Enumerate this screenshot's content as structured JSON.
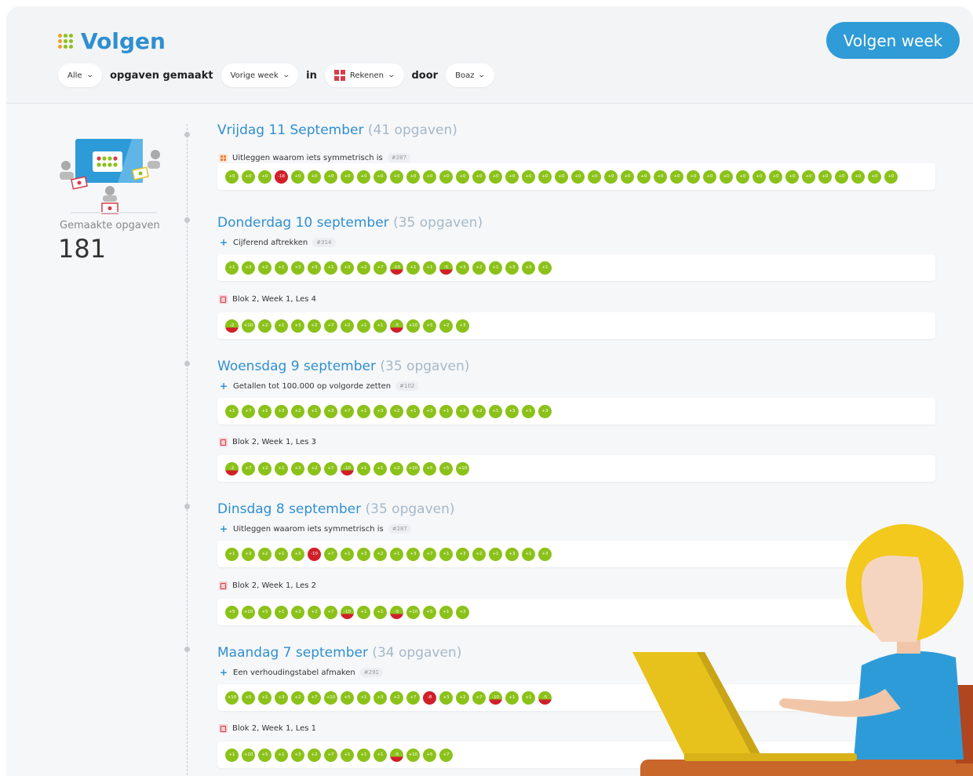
{
  "header": {
    "title": "Volgen",
    "follow_button": "Volgen week",
    "filters": {
      "scope": "Alle",
      "text1": "opgaven gemaakt",
      "period": "Vorige week",
      "text2": "in",
      "subject": "Rekenen",
      "text3": "door",
      "student": "Boaz"
    }
  },
  "sidebar": {
    "count_label": "Gemaakte opgaven",
    "count_value": "181"
  },
  "colors": {
    "accent": "#2f8fd0",
    "correct": "#8bc21a",
    "wrong": "#d01f28"
  },
  "days": [
    {
      "title": "Vrijdag 11 September",
      "count": "(41 opgaven)",
      "tasks": [
        {
          "icon": "grid-icon",
          "label": "Uitleggen waarom iets symmetrisch is",
          "id": "#287",
          "badges": [
            {
              "t": "+0",
              "s": "g"
            },
            {
              "t": "+0",
              "s": "g"
            },
            {
              "t": "+0",
              "s": "g"
            },
            {
              "t": "-18",
              "s": "r"
            },
            {
              "t": "+0",
              "s": "g"
            },
            {
              "t": "+0",
              "s": "g"
            },
            {
              "t": "+0",
              "s": "g"
            },
            {
              "t": "+0",
              "s": "g"
            },
            {
              "t": "+0",
              "s": "g"
            },
            {
              "t": "+0",
              "s": "g"
            },
            {
              "t": "+0",
              "s": "g"
            },
            {
              "t": "+0",
              "s": "g"
            },
            {
              "t": "+0",
              "s": "g"
            },
            {
              "t": "+0",
              "s": "g"
            },
            {
              "t": "+0",
              "s": "g"
            },
            {
              "t": "+0",
              "s": "g"
            },
            {
              "t": "+0",
              "s": "g"
            },
            {
              "t": "+0",
              "s": "g"
            },
            {
              "t": "+0",
              "s": "g"
            },
            {
              "t": "+0",
              "s": "g"
            },
            {
              "t": "+0",
              "s": "g"
            },
            {
              "t": "+0",
              "s": "g"
            },
            {
              "t": "+0",
              "s": "g"
            },
            {
              "t": "+0",
              "s": "g"
            },
            {
              "t": "+0",
              "s": "g"
            },
            {
              "t": "+0",
              "s": "g"
            },
            {
              "t": "+0",
              "s": "g"
            },
            {
              "t": "+0",
              "s": "g"
            },
            {
              "t": "+0",
              "s": "g"
            },
            {
              "t": "+0",
              "s": "g"
            },
            {
              "t": "+0",
              "s": "g"
            },
            {
              "t": "+0",
              "s": "g"
            },
            {
              "t": "+0",
              "s": "g"
            },
            {
              "t": "+0",
              "s": "g"
            },
            {
              "t": "+0",
              "s": "g"
            },
            {
              "t": "+0",
              "s": "g"
            },
            {
              "t": "+0",
              "s": "g"
            },
            {
              "t": "+0",
              "s": "g"
            },
            {
              "t": "+0",
              "s": "g"
            },
            {
              "t": "+0",
              "s": "g"
            },
            {
              "t": "+0",
              "s": "g"
            }
          ]
        }
      ]
    },
    {
      "title": "Donderdag 10 september",
      "count": "(35 opgaven)",
      "tasks": [
        {
          "icon": "plus-icon",
          "label": "Cijferend aftrekken",
          "id": "#314",
          "badges": [
            {
              "t": "+1",
              "s": "g"
            },
            {
              "t": "+3",
              "s": "g"
            },
            {
              "t": "+2",
              "s": "g"
            },
            {
              "t": "+1",
              "s": "g"
            },
            {
              "t": "+3",
              "s": "g"
            },
            {
              "t": "+3",
              "s": "g"
            },
            {
              "t": "+1",
              "s": "g"
            },
            {
              "t": "+3",
              "s": "g"
            },
            {
              "t": "+2",
              "s": "g"
            },
            {
              "t": "+7",
              "s": "g"
            },
            {
              "t": "-10",
              "s": "h"
            },
            {
              "t": "+1",
              "s": "g"
            },
            {
              "t": "+1",
              "s": "g"
            },
            {
              "t": "-5",
              "s": "h"
            },
            {
              "t": "+3",
              "s": "g"
            },
            {
              "t": "+2",
              "s": "g"
            },
            {
              "t": "+1",
              "s": "g"
            },
            {
              "t": "+3",
              "s": "g"
            },
            {
              "t": "+3",
              "s": "g"
            },
            {
              "t": "+1",
              "s": "g"
            }
          ]
        },
        {
          "icon": "book-icon",
          "label": "Blok 2, Week 1, Les 4",
          "id": "",
          "badges": [
            {
              "t": "-2",
              "s": "h"
            },
            {
              "t": "+10",
              "s": "g"
            },
            {
              "t": "+2",
              "s": "g"
            },
            {
              "t": "+1",
              "s": "g"
            },
            {
              "t": "+3",
              "s": "g"
            },
            {
              "t": "+2",
              "s": "g"
            },
            {
              "t": "+7",
              "s": "g"
            },
            {
              "t": "+2",
              "s": "g"
            },
            {
              "t": "+1",
              "s": "g"
            },
            {
              "t": "+1",
              "s": "g"
            },
            {
              "t": "-5",
              "s": "h"
            },
            {
              "t": "+10",
              "s": "g"
            },
            {
              "t": "+5",
              "s": "g"
            },
            {
              "t": "+2",
              "s": "g"
            },
            {
              "t": "+3",
              "s": "g"
            }
          ]
        }
      ]
    },
    {
      "title": "Woensdag 9 september",
      "count": "(35 opgaven)",
      "tasks": [
        {
          "icon": "plus-icon",
          "label": "Getallen tot 100.000 op volgorde zetten",
          "id": "#102",
          "badges": [
            {
              "t": "+1",
              "s": "g"
            },
            {
              "t": "+7",
              "s": "g"
            },
            {
              "t": "+1",
              "s": "g"
            },
            {
              "t": "+3",
              "s": "g"
            },
            {
              "t": "+2",
              "s": "g"
            },
            {
              "t": "+1",
              "s": "g"
            },
            {
              "t": "+3",
              "s": "g"
            },
            {
              "t": "+7",
              "s": "g"
            },
            {
              "t": "+1",
              "s": "g"
            },
            {
              "t": "+3",
              "s": "g"
            },
            {
              "t": "+2",
              "s": "g"
            },
            {
              "t": "+1",
              "s": "g"
            },
            {
              "t": "+3",
              "s": "g"
            },
            {
              "t": "+1",
              "s": "g"
            },
            {
              "t": "+3",
              "s": "g"
            },
            {
              "t": "+2",
              "s": "g"
            },
            {
              "t": "+1",
              "s": "g"
            },
            {
              "t": "+3",
              "s": "g"
            },
            {
              "t": "+1",
              "s": "g"
            },
            {
              "t": "+3",
              "s": "g"
            }
          ]
        },
        {
          "icon": "book-icon",
          "label": "Blok 2, Week 1, Les 3",
          "id": "",
          "badges": [
            {
              "t": "-2",
              "s": "h"
            },
            {
              "t": "+7",
              "s": "g"
            },
            {
              "t": "+2",
              "s": "g"
            },
            {
              "t": "+1",
              "s": "g"
            },
            {
              "t": "+3",
              "s": "g"
            },
            {
              "t": "+2",
              "s": "g"
            },
            {
              "t": "+7",
              "s": "g"
            },
            {
              "t": "-10",
              "s": "h"
            },
            {
              "t": "+1",
              "s": "g"
            },
            {
              "t": "+1",
              "s": "g"
            },
            {
              "t": "+2",
              "s": "g"
            },
            {
              "t": "+10",
              "s": "g"
            },
            {
              "t": "+5",
              "s": "g"
            },
            {
              "t": "+5",
              "s": "g"
            },
            {
              "t": "+10",
              "s": "g"
            }
          ]
        }
      ]
    },
    {
      "title": "Dinsdag 8 september",
      "count": "(35 opgaven)",
      "tasks": [
        {
          "icon": "plus-icon",
          "label": "Uitleggen waarom iets symmetrisch is",
          "id": "#287",
          "badges": [
            {
              "t": "+1",
              "s": "g"
            },
            {
              "t": "+3",
              "s": "g"
            },
            {
              "t": "+2",
              "s": "g"
            },
            {
              "t": "+1",
              "s": "g"
            },
            {
              "t": "+3",
              "s": "g"
            },
            {
              "t": "-10",
              "s": "r"
            },
            {
              "t": "+7",
              "s": "g"
            },
            {
              "t": "+1",
              "s": "g"
            },
            {
              "t": "+3",
              "s": "g"
            },
            {
              "t": "+2",
              "s": "g"
            },
            {
              "t": "+1",
              "s": "g"
            },
            {
              "t": "+3",
              "s": "g"
            },
            {
              "t": "+7",
              "s": "g"
            },
            {
              "t": "+1",
              "s": "g"
            },
            {
              "t": "+3",
              "s": "g"
            },
            {
              "t": "+2",
              "s": "g"
            },
            {
              "t": "+1",
              "s": "g"
            },
            {
              "t": "+3",
              "s": "g"
            },
            {
              "t": "+1",
              "s": "g"
            },
            {
              "t": "+3",
              "s": "g"
            }
          ]
        },
        {
          "icon": "book-icon",
          "label": "Blok 2, Week 1, Les 2",
          "id": "",
          "badges": [
            {
              "t": "+5",
              "s": "g"
            },
            {
              "t": "+10",
              "s": "g"
            },
            {
              "t": "+5",
              "s": "g"
            },
            {
              "t": "+1",
              "s": "g"
            },
            {
              "t": "+3",
              "s": "g"
            },
            {
              "t": "+2",
              "s": "g"
            },
            {
              "t": "+7",
              "s": "g"
            },
            {
              "t": "-10",
              "s": "h"
            },
            {
              "t": "+1",
              "s": "g"
            },
            {
              "t": "+1",
              "s": "g"
            },
            {
              "t": "-5",
              "s": "h"
            },
            {
              "t": "+10",
              "s": "g"
            },
            {
              "t": "+5",
              "s": "g"
            },
            {
              "t": "+1",
              "s": "g"
            },
            {
              "t": "+3",
              "s": "g"
            }
          ]
        }
      ]
    },
    {
      "title": "Maandag 7 september",
      "count": "(34 opgaven)",
      "tasks": [
        {
          "icon": "plus-icon",
          "label": "Een verhoudingstabel afmaken",
          "id": "#291",
          "badges": [
            {
              "t": "+10",
              "s": "g"
            },
            {
              "t": "+5",
              "s": "g"
            },
            {
              "t": "+1",
              "s": "g"
            },
            {
              "t": "+3",
              "s": "g"
            },
            {
              "t": "+2",
              "s": "g"
            },
            {
              "t": "+7",
              "s": "g"
            },
            {
              "t": "+10",
              "s": "g"
            },
            {
              "t": "+5",
              "s": "g"
            },
            {
              "t": "+1",
              "s": "g"
            },
            {
              "t": "+3",
              "s": "g"
            },
            {
              "t": "+2",
              "s": "g"
            },
            {
              "t": "+7",
              "s": "g"
            },
            {
              "t": "-8",
              "s": "r"
            },
            {
              "t": "+3",
              "s": "g"
            },
            {
              "t": "+2",
              "s": "g"
            },
            {
              "t": "+7",
              "s": "g"
            },
            {
              "t": "-10",
              "s": "h"
            },
            {
              "t": "+1",
              "s": "g"
            },
            {
              "t": "+1",
              "s": "g"
            },
            {
              "t": "-5",
              "s": "h"
            }
          ]
        },
        {
          "icon": "book-icon",
          "label": "Blok 2, Week 1, Les 1",
          "id": "",
          "badges": [
            {
              "t": "+1",
              "s": "g"
            },
            {
              "t": "+10",
              "s": "g"
            },
            {
              "t": "+5",
              "s": "g"
            },
            {
              "t": "+1",
              "s": "g"
            },
            {
              "t": "+3",
              "s": "g"
            },
            {
              "t": "+2",
              "s": "g"
            },
            {
              "t": "+7",
              "s": "g"
            },
            {
              "t": "+1",
              "s": "g"
            },
            {
              "t": "+1",
              "s": "g"
            },
            {
              "t": "+1",
              "s": "g"
            },
            {
              "t": "-5",
              "s": "h"
            },
            {
              "t": "+10",
              "s": "g"
            },
            {
              "t": "+5",
              "s": "g"
            },
            {
              "t": "+7",
              "s": "g"
            }
          ]
        }
      ]
    }
  ]
}
